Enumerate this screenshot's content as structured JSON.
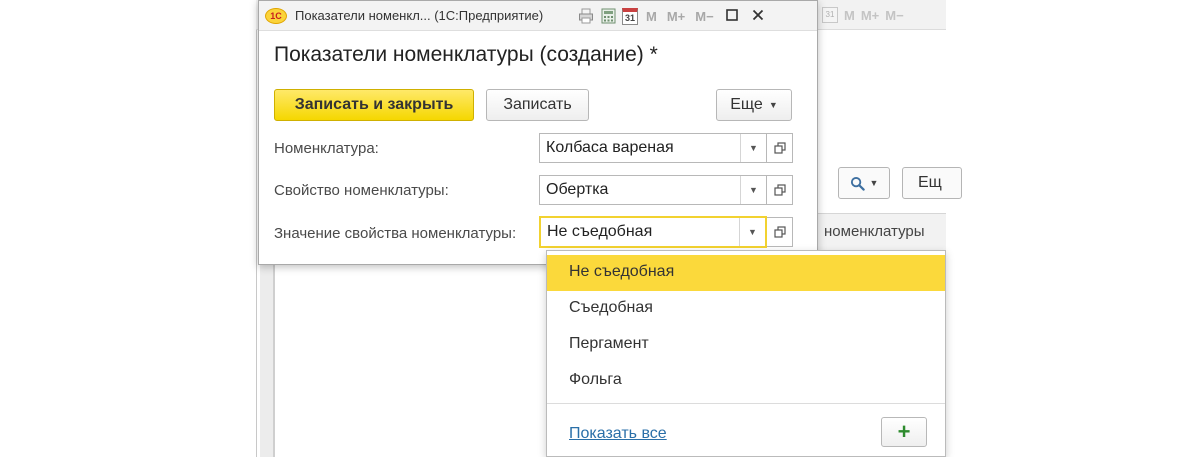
{
  "dialog": {
    "window_title": "Показатели номенкл... (1С:Предприятие)",
    "app_logo_text": "1С",
    "toolbar_m_labels": [
      "M",
      "M+",
      "M−"
    ],
    "calendar_day": "31",
    "form_title": "Показатели номенклатуры (создание) *",
    "buttons": {
      "save_close": "Записать и закрыть",
      "save": "Записать",
      "more": "Еще"
    },
    "fields": [
      {
        "label": "Номенклатура:",
        "value": "Колбаса вареная"
      },
      {
        "label": "Свойство номенклатуры:",
        "value": "Обертка"
      },
      {
        "label": "Значение свойства номенклатуры:",
        "value": "Не съедобная"
      }
    ]
  },
  "dropdown": {
    "items": [
      "Не съедобная",
      "Съедобная",
      "Пергамент",
      "Фольга"
    ],
    "selected_index": 0,
    "show_all": "Показать все",
    "add_symbol": "+"
  },
  "background_window": {
    "more_button": "Ещ",
    "column_header": "номенклатуры",
    "calendar_day": "31",
    "m_labels": [
      "M",
      "M+",
      "M−"
    ]
  },
  "colors": {
    "accent_yellow": "#f5d700",
    "selection_yellow": "#fbd93b",
    "link_blue": "#2a6fa8",
    "add_green": "#2e8b2e"
  }
}
